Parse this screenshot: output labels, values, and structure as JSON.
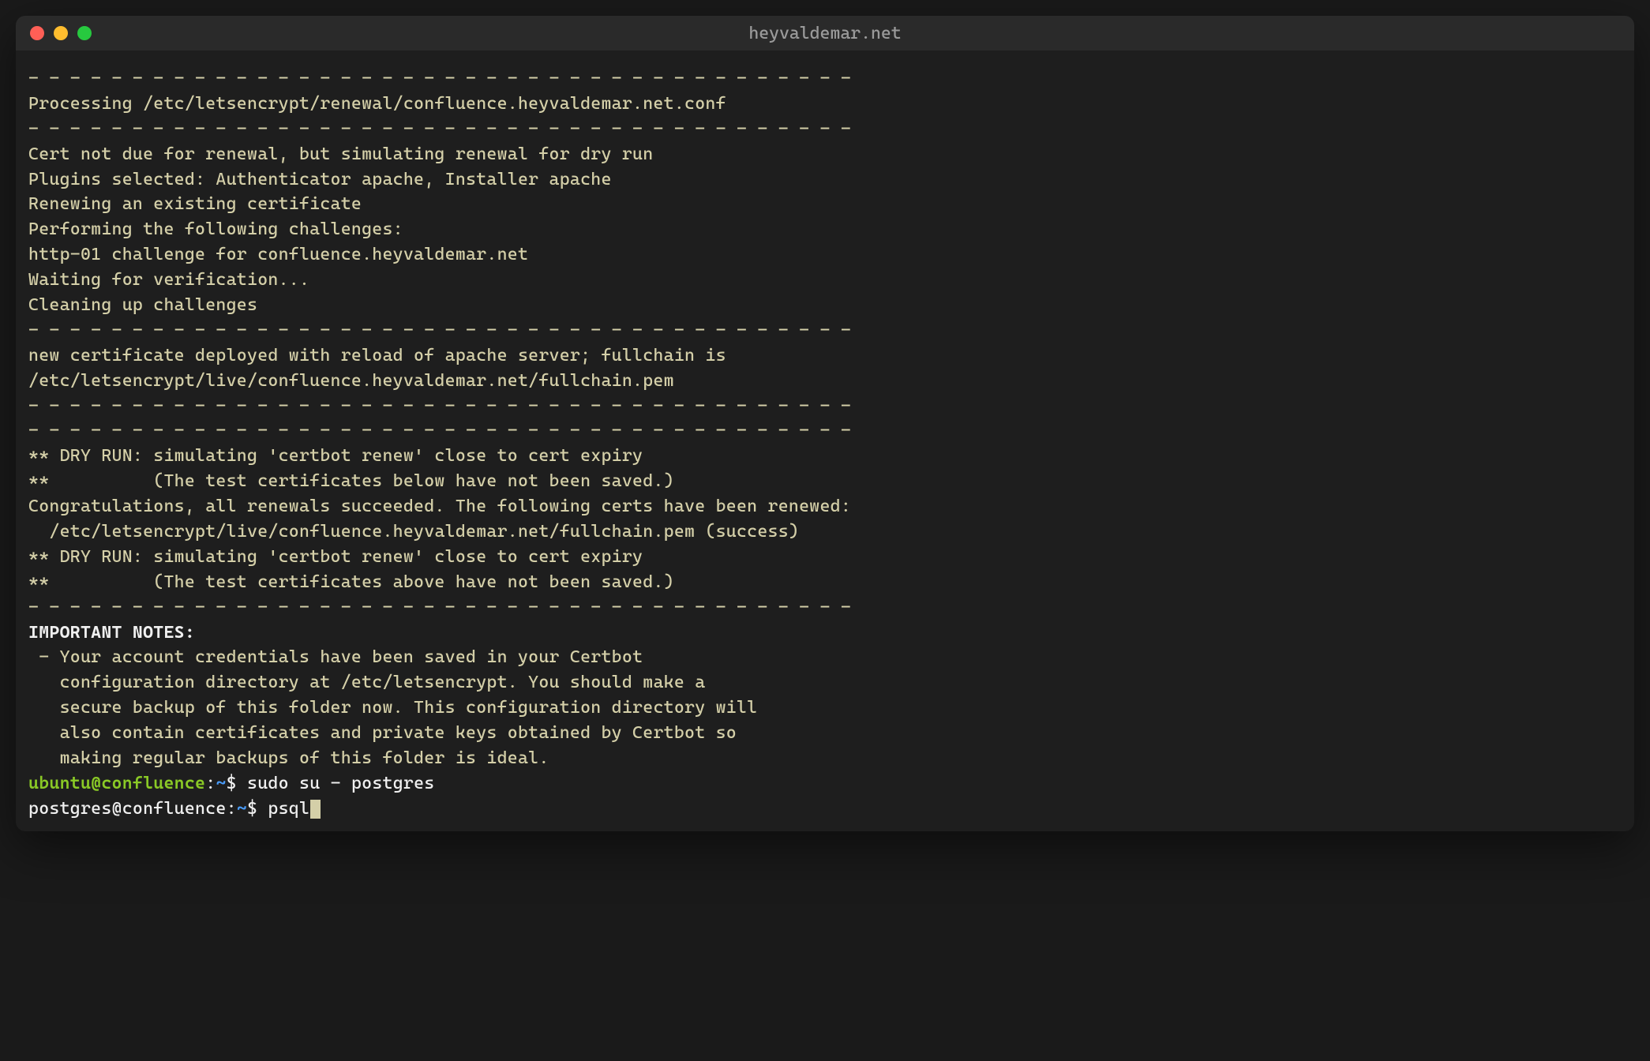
{
  "window": {
    "title": "heyvaldemar.net"
  },
  "terminal": {
    "lines": [
      "- - - - - - - - - - - - - - - - - - - - - - - - - - - - - - - - - - - - - - - -",
      "Processing /etc/letsencrypt/renewal/confluence.heyvaldemar.net.conf",
      "- - - - - - - - - - - - - - - - - - - - - - - - - - - - - - - - - - - - - - - -",
      "Cert not due for renewal, but simulating renewal for dry run",
      "Plugins selected: Authenticator apache, Installer apache",
      "Renewing an existing certificate",
      "Performing the following challenges:",
      "http-01 challenge for confluence.heyvaldemar.net",
      "Waiting for verification...",
      "Cleaning up challenges",
      "",
      "- - - - - - - - - - - - - - - - - - - - - - - - - - - - - - - - - - - - - - - -",
      "new certificate deployed with reload of apache server; fullchain is",
      "/etc/letsencrypt/live/confluence.heyvaldemar.net/fullchain.pem",
      "- - - - - - - - - - - - - - - - - - - - - - - - - - - - - - - - - - - - - - - -",
      "",
      "- - - - - - - - - - - - - - - - - - - - - - - - - - - - - - - - - - - - - - - -",
      "** DRY RUN: simulating 'certbot renew' close to cert expiry",
      "**          (The test certificates below have not been saved.)",
      "",
      "Congratulations, all renewals succeeded. The following certs have been renewed:",
      "  /etc/letsencrypt/live/confluence.heyvaldemar.net/fullchain.pem (success)",
      "** DRY RUN: simulating 'certbot renew' close to cert expiry",
      "**          (The test certificates above have not been saved.)",
      "- - - - - - - - - - - - - - - - - - - - - - - - - - - - - - - - - - - - - - - -",
      ""
    ],
    "notes_title": "IMPORTANT NOTES:",
    "notes_lines": [
      " - Your account credentials have been saved in your Certbot",
      "   configuration directory at /etc/letsencrypt. You should make a",
      "   secure backup of this folder now. This configuration directory will",
      "   also contain certificates and private keys obtained by Certbot so",
      "   making regular backups of this folder is ideal."
    ],
    "prompt1": {
      "user_host": "ubuntu@confluence",
      "colon": ":",
      "path": "~",
      "dollar": "$ ",
      "command": "sudo su - postgres"
    },
    "prompt2": {
      "user_host": "postgres@confluence",
      "colon": ":",
      "path": "~",
      "dollar": "$ ",
      "command": "psql"
    }
  }
}
